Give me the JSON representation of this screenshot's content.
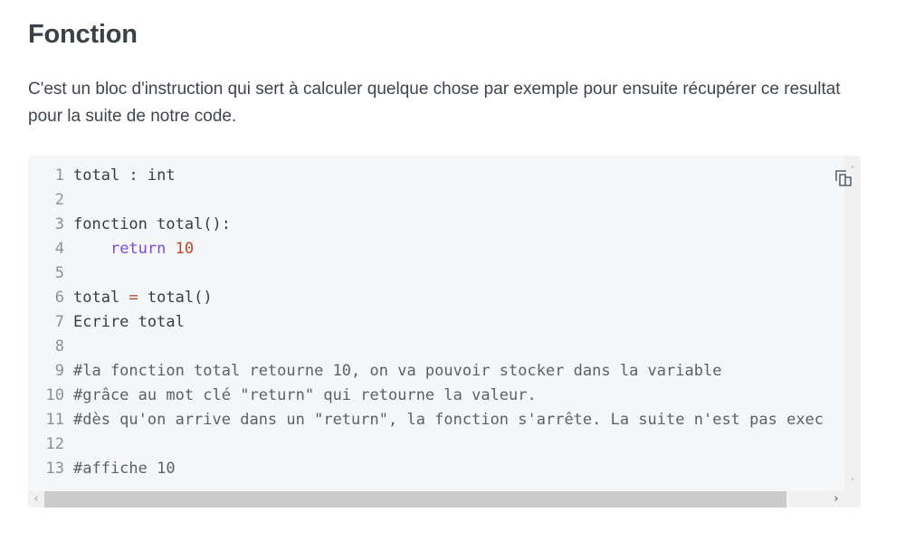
{
  "section": {
    "title": "Fonction",
    "description": "C'est un bloc d'instruction qui sert à calculer quelque chose par exemple pour ensuite récupérer ce resultat pour la suite de notre code."
  },
  "code": {
    "lines": [
      {
        "n": "1",
        "tokens": [
          {
            "t": "total : int",
            "c": "src"
          }
        ]
      },
      {
        "n": "2",
        "tokens": []
      },
      {
        "n": "3",
        "tokens": [
          {
            "t": "fonction total():",
            "c": "src"
          }
        ]
      },
      {
        "n": "4",
        "tokens": [
          {
            "t": "    ",
            "c": "src"
          },
          {
            "t": "return",
            "c": "kw"
          },
          {
            "t": " ",
            "c": "src"
          },
          {
            "t": "10",
            "c": "num"
          }
        ]
      },
      {
        "n": "5",
        "tokens": []
      },
      {
        "n": "6",
        "tokens": [
          {
            "t": "total ",
            "c": "src"
          },
          {
            "t": "=",
            "c": "op"
          },
          {
            "t": " total()",
            "c": "src"
          }
        ]
      },
      {
        "n": "7",
        "tokens": [
          {
            "t": "Ecrire total",
            "c": "src"
          }
        ]
      },
      {
        "n": "8",
        "tokens": []
      },
      {
        "n": "9",
        "tokens": [
          {
            "t": "#la fonction total retourne 10, on va pouvoir stocker dans la variable",
            "c": "cm"
          }
        ]
      },
      {
        "n": "10",
        "tokens": [
          {
            "t": "#grâce au mot clé \"return\" qui retourne la valeur.",
            "c": "cm"
          }
        ]
      },
      {
        "n": "11",
        "tokens": [
          {
            "t": "#dès qu'on arrive dans un \"return\", la fonction s'arrête. La suite n'est pas exec",
            "c": "cm"
          }
        ]
      },
      {
        "n": "12",
        "tokens": []
      },
      {
        "n": "13",
        "tokens": [
          {
            "t": "#affiche 10",
            "c": "cm"
          }
        ]
      }
    ]
  },
  "controls": {
    "copy_icon": "copy-icon",
    "scroll_up_glyph": "˄",
    "scroll_down_glyph": "˅",
    "scroll_left_glyph": "‹",
    "scroll_right_glyph": "›"
  }
}
